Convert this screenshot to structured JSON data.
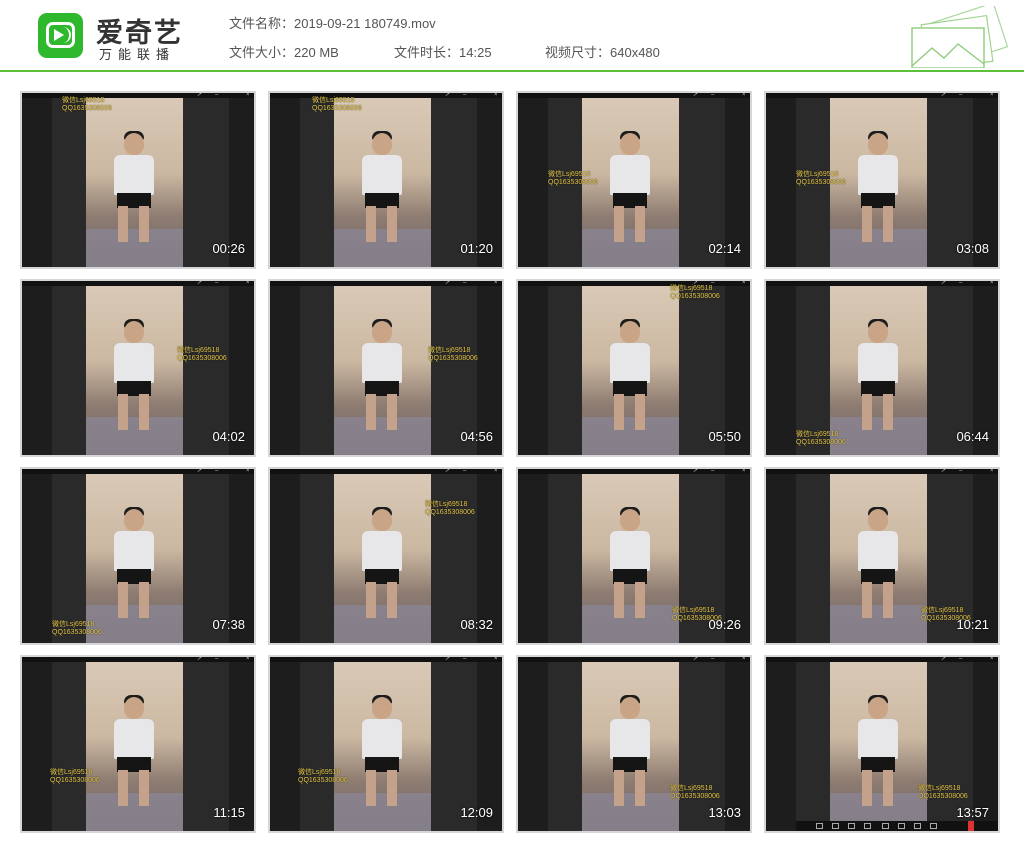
{
  "app": {
    "brand": "爱奇艺",
    "brand_sub": "万能联播"
  },
  "file": {
    "name_label": "文件名称：",
    "name_value": "2019-09-21 180749.mov",
    "size_label": "文件大小：",
    "size_value": "220 MB",
    "duration_label": "文件时长：",
    "duration_value": "14:25",
    "dims_label": "视频尺寸：",
    "dims_value": "640x480"
  },
  "colors": {
    "accent": "#5cbf3a",
    "logo": "#2eb82e",
    "watermark": "#e8c94a"
  },
  "watermark": {
    "line1": "微信Lsj69518",
    "line2": "QQ1635308006"
  },
  "thumbnails": [
    {
      "time": "00:26"
    },
    {
      "time": "01:20"
    },
    {
      "time": "02:14"
    },
    {
      "time": "03:08"
    },
    {
      "time": "04:02"
    },
    {
      "time": "04:56"
    },
    {
      "time": "05:50"
    },
    {
      "time": "06:44"
    },
    {
      "time": "07:38"
    },
    {
      "time": "08:32"
    },
    {
      "time": "09:26"
    },
    {
      "time": "10:21"
    },
    {
      "time": "11:15"
    },
    {
      "time": "12:09"
    },
    {
      "time": "13:03"
    },
    {
      "time": "13:57"
    }
  ]
}
